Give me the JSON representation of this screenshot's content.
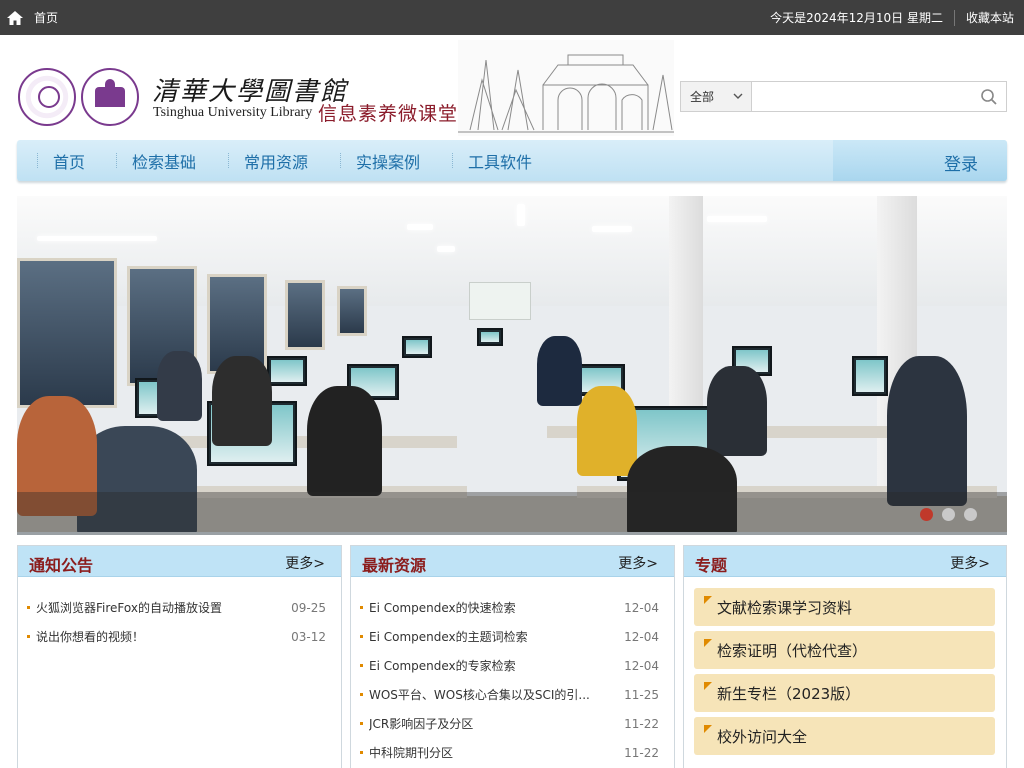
{
  "topbar": {
    "home_label": "首页",
    "date_text": "今天是2024年12月10日 星期二",
    "favorite_label": "收藏本站"
  },
  "header": {
    "logo_cn": "清華大學圖書館",
    "logo_en": "Tsinghua University Library",
    "logo_sub": "信息素养微课堂"
  },
  "search": {
    "scope_selected": "全部",
    "placeholder": ""
  },
  "nav": {
    "items": [
      "首页",
      "检索基础",
      "常用资源",
      "实操案例",
      "工具软件"
    ],
    "login_label": "登录"
  },
  "banner": {
    "slide_count": 3,
    "active_slide": 1
  },
  "notices": {
    "title": "通知公告",
    "more": "更多>",
    "items": [
      {
        "text": "火狐浏览器FireFox的自动播放设置",
        "date": "09-25"
      },
      {
        "text": "说出你想看的视频！",
        "date": "03-12"
      }
    ]
  },
  "latest": {
    "title": "最新资源",
    "more": "更多>",
    "items": [
      {
        "text": "Ei Compendex的快速检索",
        "date": "12-04"
      },
      {
        "text": "Ei Compendex的主题词检索",
        "date": "12-04"
      },
      {
        "text": "Ei Compendex的专家检索",
        "date": "12-04"
      },
      {
        "text": "WOS平台、WOS核心合集以及SCI的引...",
        "date": "11-25"
      },
      {
        "text": "JCR影响因子及分区",
        "date": "11-22"
      },
      {
        "text": "中科院期刊分区",
        "date": "11-22"
      }
    ]
  },
  "topics": {
    "title": "专题",
    "more": "更多>",
    "items": [
      "文献检索课学习资料",
      "检索证明（代检代查）",
      "新生专栏（2023版）",
      "校外访问大全"
    ]
  },
  "colors": {
    "topbar_bg": "#3f3f3f",
    "nav_text": "#1e6fa8",
    "panel_title": "#8b1c1c",
    "topic_bg": "#f6e4b8",
    "accent_dot": "#c0392b"
  }
}
